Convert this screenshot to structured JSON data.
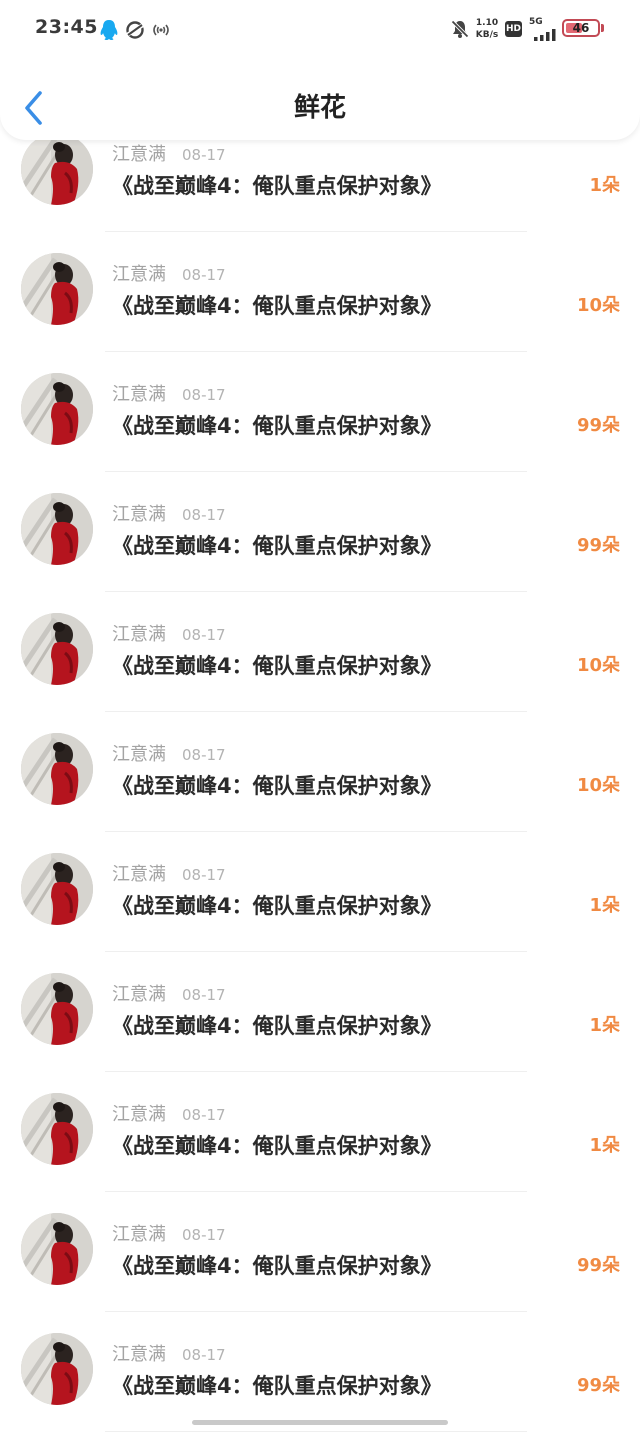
{
  "status_bar": {
    "time": "23:45",
    "net_speed_value": "1.10",
    "net_speed_unit": "KB/s",
    "hd_label": "HD",
    "network_label": "5G",
    "battery_level": "46",
    "icons": [
      "qq-icon",
      "sync-icon",
      "hotspot-icon",
      "mute-bell-icon",
      "signal-icon",
      "battery-icon"
    ]
  },
  "header": {
    "title": "鲜花",
    "back_icon": "chevron-left-icon",
    "accent_color": "#3a8ee6"
  },
  "colors": {
    "count": "#f08a43",
    "name": "#a3a3a3",
    "title": "#2a2a2a"
  },
  "records": [
    {
      "name": "江意满",
      "date": "08-17",
      "title": "《战至巅峰4：俺队重点保护对象》",
      "count": "1朵"
    },
    {
      "name": "江意满",
      "date": "08-17",
      "title": "《战至巅峰4：俺队重点保护对象》",
      "count": "10朵"
    },
    {
      "name": "江意满",
      "date": "08-17",
      "title": "《战至巅峰4：俺队重点保护对象》",
      "count": "99朵"
    },
    {
      "name": "江意满",
      "date": "08-17",
      "title": "《战至巅峰4：俺队重点保护对象》",
      "count": "99朵"
    },
    {
      "name": "江意满",
      "date": "08-17",
      "title": "《战至巅峰4：俺队重点保护对象》",
      "count": "10朵"
    },
    {
      "name": "江意满",
      "date": "08-17",
      "title": "《战至巅峰4：俺队重点保护对象》",
      "count": "10朵"
    },
    {
      "name": "江意满",
      "date": "08-17",
      "title": "《战至巅峰4：俺队重点保护对象》",
      "count": "1朵"
    },
    {
      "name": "江意满",
      "date": "08-17",
      "title": "《战至巅峰4：俺队重点保护对象》",
      "count": "1朵"
    },
    {
      "name": "江意满",
      "date": "08-17",
      "title": "《战至巅峰4：俺队重点保护对象》",
      "count": "1朵"
    },
    {
      "name": "江意满",
      "date": "08-17",
      "title": "《战至巅峰4：俺队重点保护对象》",
      "count": "99朵"
    },
    {
      "name": "江意满",
      "date": "08-17",
      "title": "《战至巅峰4：俺队重点保护对象》",
      "count": "99朵"
    }
  ]
}
